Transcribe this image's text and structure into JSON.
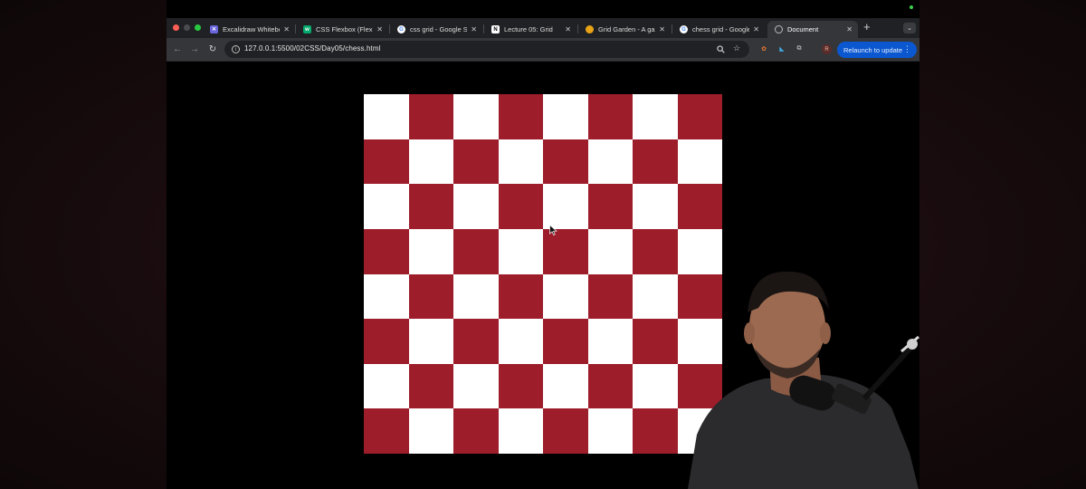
{
  "browser": {
    "tabs": [
      {
        "title": "Excalidraw Whiteboard",
        "favicon": "excalidraw-icon",
        "active": false
      },
      {
        "title": "CSS Flexbox (Flexible Box)",
        "favicon": "w3schools-icon",
        "active": false
      },
      {
        "title": "css grid - Google Search",
        "favicon": "google-icon",
        "active": false
      },
      {
        "title": "Lecture 05: Grid",
        "favicon": "notion-icon",
        "active": false
      },
      {
        "title": "Grid Garden - A game",
        "favicon": "carrot-icon",
        "active": false
      },
      {
        "title": "chess grid - Google Search",
        "favicon": "google-icon",
        "active": false
      },
      {
        "title": "Document",
        "favicon": "globe-icon",
        "active": true
      }
    ],
    "new_tab_label": "+",
    "address": {
      "url": "127.0.0.1:5500/02CSS/Day05/chess.html"
    },
    "profile_initial": "R",
    "relaunch_label": "Relaunch to update"
  },
  "page": {
    "board": {
      "rows": 8,
      "columns": 8,
      "light_color": "#ffffff",
      "dark_color": "#9d1d2a",
      "top_left": "light"
    }
  },
  "colors": {
    "tab_strip": "#202124",
    "toolbar": "#35363a",
    "relaunch_button": "#0b57d0"
  }
}
